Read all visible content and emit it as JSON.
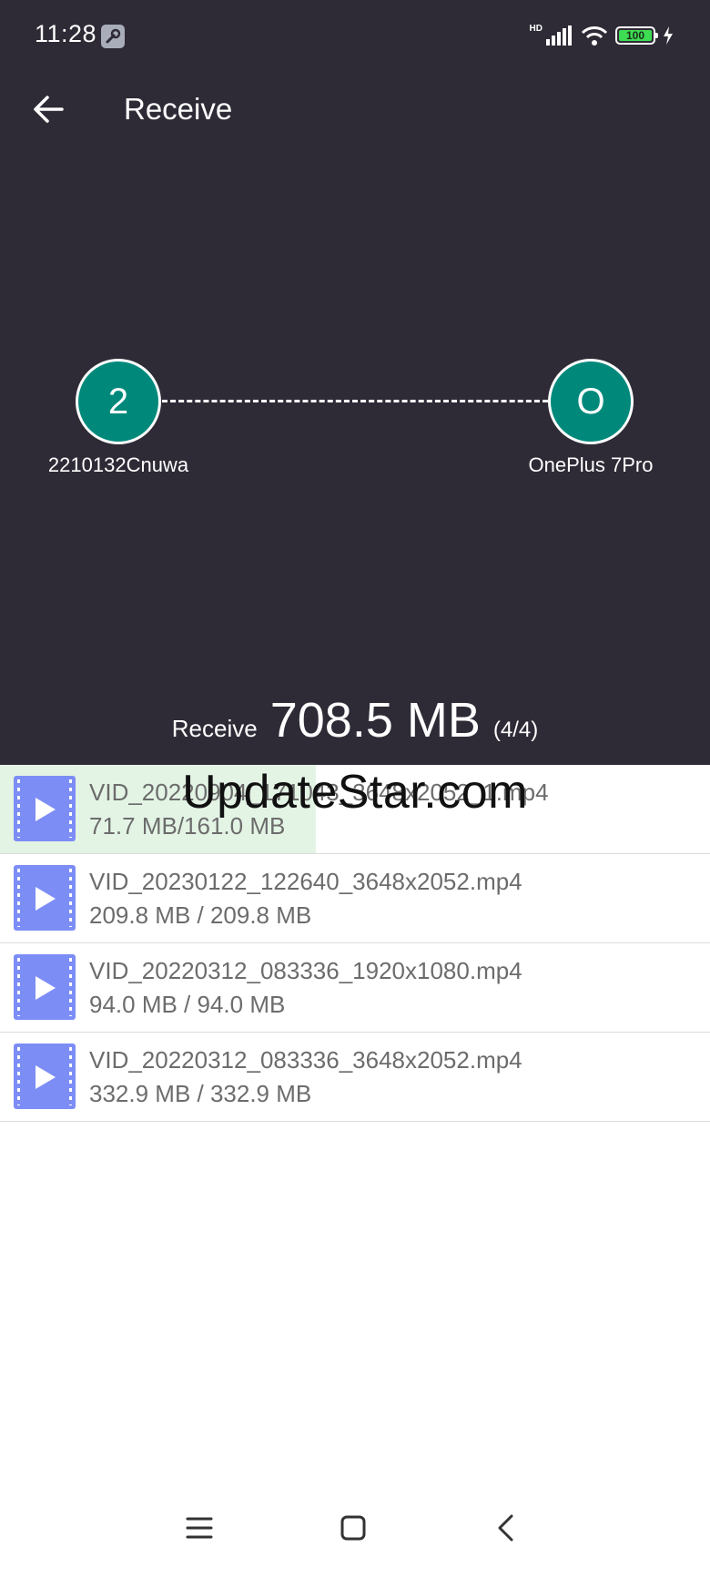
{
  "status_bar": {
    "time": "11:28",
    "network_label": "HD",
    "battery_level": "100"
  },
  "appbar": {
    "title": "Receive"
  },
  "transfer": {
    "sender": {
      "initial": "2",
      "name": "2210132Cnuwa"
    },
    "receiver": {
      "initial": "O",
      "name": "OnePlus 7Pro"
    },
    "summary_label": "Receive",
    "total_size": "708.5 MB",
    "count": "(4/4)"
  },
  "files": [
    {
      "name": "VID_20220904_171043_3648x2052_1.mp4",
      "size": "71.7 MB/161.0 MB",
      "progress": 0.445
    },
    {
      "name": "VID_20230122_122640_3648x2052.mp4",
      "size": "209.8 MB / 209.8 MB",
      "progress": 1
    },
    {
      "name": "VID_20220312_083336_1920x1080.mp4",
      "size": "94.0 MB / 94.0 MB",
      "progress": 1
    },
    {
      "name": "VID_20220312_083336_3648x2052.mp4",
      "size": "332.9 MB / 332.9 MB",
      "progress": 1
    }
  ],
  "watermark": "UpdateStar.com",
  "colors": {
    "header_bg": "#2e2b36",
    "avatar_bg": "#00897b",
    "file_icon": "#7c8df5",
    "progress_fill": "#e3f4e5",
    "battery": "#3ddc52"
  },
  "icons": {
    "back": "arrow-left-icon",
    "wrench": "wrench-icon",
    "signal": "signal-icon",
    "wifi": "wifi-icon",
    "charging": "lightning-icon",
    "video": "video-file-icon",
    "nav_menu": "menu-icon",
    "nav_home": "home-square-icon",
    "nav_back": "chevron-left-icon"
  }
}
